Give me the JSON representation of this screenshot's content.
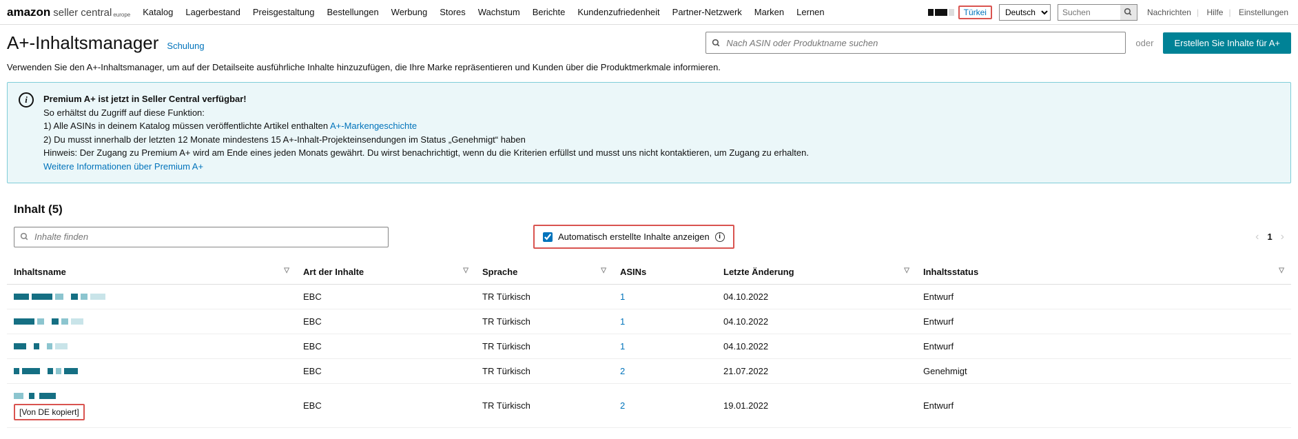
{
  "header": {
    "logo": {
      "amazon": "amazon",
      "seller": "seller central",
      "region": "europe"
    },
    "nav": [
      "Katalog",
      "Lagerbestand",
      "Preisgestaltung",
      "Bestellungen",
      "Werbung",
      "Stores",
      "Wachstum",
      "Berichte",
      "Kundenzufriedenheit",
      "Partner-Netzwerk",
      "Marken",
      "Lernen"
    ],
    "country": "Türkei",
    "language": "Deutsch",
    "search_placeholder": "Suchen",
    "right_links": [
      "Nachrichten",
      "Hilfe",
      "Einstellungen"
    ]
  },
  "page": {
    "title": "A+-Inhaltsmanager",
    "training_link": "Schulung",
    "asin_search_placeholder": "Nach ASIN oder Produktname suchen",
    "or": "oder",
    "create_btn": "Erstellen Sie Inhalte für A+",
    "description": "Verwenden Sie den A+-Inhaltsmanager, um auf der Detailseite ausführliche Inhalte hinzuzufügen, die Ihre Marke repräsentieren und Kunden über die Produktmerkmale informieren."
  },
  "banner": {
    "title": "Premium A+ ist jetzt in Seller Central verfügbar!",
    "line_intro": "So erhältst du Zugriff auf diese Funktion:",
    "line1_a": "1) Alle ASINs in deinem Katalog müssen veröffentlichte Artikel enthalten ",
    "line1_link": "A+-Markengeschichte",
    "line2": "2) Du musst innerhalb der letzten 12 Monate mindestens 15 A+-Inhalt-Projekteinsendungen im Status „Genehmigt“ haben",
    "line3": "Hinweis: Der Zugang zu Premium A+ wird am Ende eines jeden Monats gewährt. Du wirst benachrichtigt, wenn du die Kriterien erfüllst und musst uns nicht kontaktieren, um Zugang zu erhalten.",
    "more_link": "Weitere Informationen über Premium A+"
  },
  "content": {
    "heading": "Inhalt (5)",
    "filter_placeholder": "Inhalte finden",
    "auto_label": "Automatisch erstellte Inhalte anzeigen",
    "page_num": "1",
    "columns": {
      "name": "Inhaltsname",
      "type": "Art der Inhalte",
      "lang": "Sprache",
      "asins": "ASINs",
      "modified": "Letzte Änderung",
      "status": "Inhaltsstatus"
    },
    "rows": [
      {
        "type": "EBC",
        "lang": "TR Türkisch",
        "asins": "1",
        "modified": "04.10.2022",
        "status": "Entwurf"
      },
      {
        "type": "EBC",
        "lang": "TR Türkisch",
        "asins": "1",
        "modified": "04.10.2022",
        "status": "Entwurf"
      },
      {
        "type": "EBC",
        "lang": "TR Türkisch",
        "asins": "1",
        "modified": "04.10.2022",
        "status": "Entwurf"
      },
      {
        "type": "EBC",
        "lang": "TR Türkisch",
        "asins": "2",
        "modified": "21.07.2022",
        "status": "Genehmigt"
      },
      {
        "type": "EBC",
        "lang": "TR Türkisch",
        "asins": "2",
        "modified": "19.01.2022",
        "status": "Entwurf"
      }
    ],
    "copied_tag": "[Von DE kopiert]"
  }
}
